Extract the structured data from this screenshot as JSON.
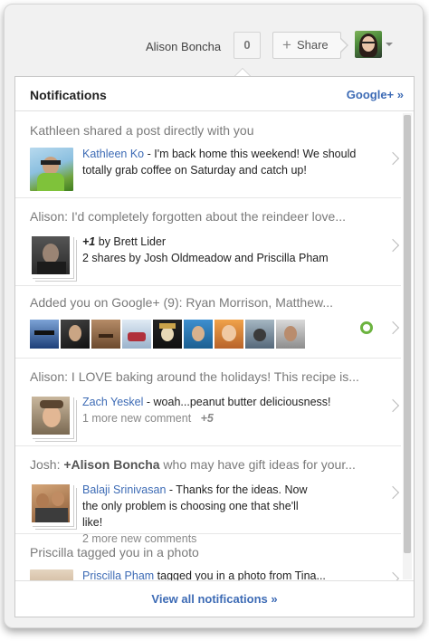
{
  "topbar": {
    "user_name": "Alison Boncha",
    "notification_count": "0",
    "share_label": "Share",
    "share_icon": "plus-icon",
    "avatar_icon": "profile-avatar"
  },
  "panel": {
    "title": "Notifications",
    "gplus_link": "Google+ »",
    "footer_link": "View all notifications »"
  },
  "notifications": [
    {
      "title": "Kathleen shared a post directly with you",
      "author": "Kathleen Ko",
      "text": " - I'm back home this weekend! We should totally grab coffee on Saturday and catch up!"
    },
    {
      "title": "Alison: I'd completely forgotten about the reindeer love...",
      "plus_one": "+1",
      "plus_one_by": " by Brett Lider",
      "shares": "2 shares by Josh Oldmeadow and Priscilla Pham"
    },
    {
      "title": "Added you on Google+ (9): Ryan Morrison, Matthew..."
    },
    {
      "title": "Alison: I LOVE baking around the holidays! This recipe is...",
      "author": "Zach Yeskel",
      "text": " - woah...peanut butter deliciousness!",
      "more": "1 more new comment",
      "plus": "+5"
    },
    {
      "title_prefix": "Josh: ",
      "title_bold": "+Alison Boncha",
      "title_rest": " who may have gift ideas for your...",
      "author": "Balaji Srinivasan",
      "text": "  - Thanks for the ideas. Now the only problem is choosing one that she'll like!",
      "more": "2 more new comments"
    },
    {
      "title": "Priscilla tagged you in a photo",
      "author": "Priscilla Pham",
      "text": " tagged you in a photo from Tina..."
    }
  ],
  "colors": {
    "link": "#3d6bb5",
    "ring": "#6cb33f",
    "background": "#f1f1f1"
  }
}
